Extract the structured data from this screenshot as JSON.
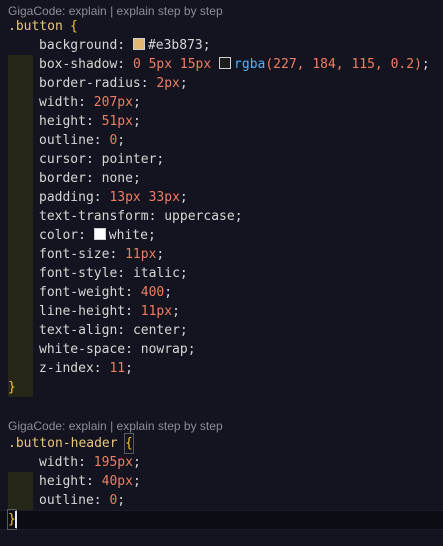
{
  "code_lens": {
    "label": "GigaCode: explain",
    "separator": "|",
    "action": "explain step by step"
  },
  "colors": {
    "background_swatch": "#e3b873",
    "shadow_swatch": "rgba(227, 184, 115, 0.2)",
    "color_swatch": "#ffffff"
  },
  "block1": {
    "selector": ".button",
    "open_brace": "{",
    "close_brace": "}",
    "decls": [
      {
        "prop": "background",
        "value": "#e3b873"
      },
      {
        "prop": "box-shadow",
        "n1": "0",
        "n2": "5px",
        "n3": "15px",
        "fn": "rgba",
        "args": "(227, 184, 115, 0.2)"
      },
      {
        "prop": "border-radius",
        "value": "2px"
      },
      {
        "prop": "width",
        "value": "207px"
      },
      {
        "prop": "height",
        "value": "51px"
      },
      {
        "prop": "outline",
        "value": "0"
      },
      {
        "prop": "cursor",
        "value": "pointer"
      },
      {
        "prop": "border",
        "value": "none"
      },
      {
        "prop": "padding",
        "n1": "13px",
        "n2": "33px"
      },
      {
        "prop": "text-transform",
        "value": "uppercase"
      },
      {
        "prop": "color",
        "value": "white"
      },
      {
        "prop": "font-size",
        "value": "11px"
      },
      {
        "prop": "font-style",
        "value": "italic"
      },
      {
        "prop": "font-weight",
        "value": "400"
      },
      {
        "prop": "line-height",
        "value": "11px"
      },
      {
        "prop": "text-align",
        "value": "center"
      },
      {
        "prop": "white-space",
        "value": "nowrap"
      },
      {
        "prop": "z-index",
        "value": "11"
      }
    ]
  },
  "block2": {
    "selector": ".button-header",
    "open_brace": "{",
    "close_brace": "}",
    "decls": [
      {
        "prop": "width",
        "value": "195px"
      },
      {
        "prop": "height",
        "value": "40px"
      },
      {
        "prop": "outline",
        "value": "0"
      }
    ]
  }
}
